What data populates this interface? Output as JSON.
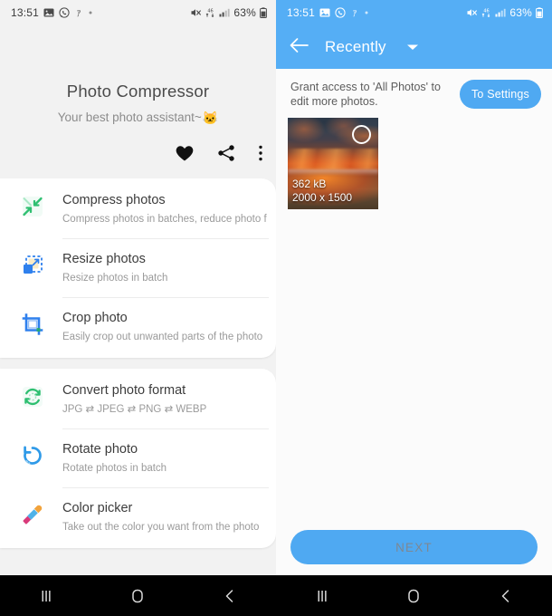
{
  "status_bar": {
    "time": "13:51",
    "left_icons": [
      "gallery-icon",
      "whatsapp-icon",
      "japanese-app-icon",
      "dot-icon"
    ],
    "right_icons": [
      "mute-icon",
      "network-transfer-icon",
      "signal-bars-icon"
    ],
    "battery_percent": "63%",
    "battery_icon": "battery-icon"
  },
  "left_screen": {
    "title": "Photo Compressor",
    "subtitle": "Your best photo assistant~",
    "subtitle_emoji": "🐱",
    "actions": [
      {
        "name": "favorite-button",
        "icon": "heart-icon"
      },
      {
        "name": "share-button",
        "icon": "share-icon"
      },
      {
        "name": "more-options-button",
        "icon": "more-vertical-icon"
      }
    ],
    "cards": [
      {
        "items": [
          {
            "title": "Compress photos",
            "desc": "Compress photos in batches, reduce photo fi..",
            "icon": "compress-arrows-icon"
          },
          {
            "title": "Resize photos",
            "desc": "Resize photos in batch",
            "icon": "resize-icon"
          },
          {
            "title": "Crop photo",
            "desc": "Easily crop out unwanted parts of the photo",
            "icon": "crop-icon"
          }
        ]
      },
      {
        "items": [
          {
            "title": "Convert photo format",
            "desc": "JPG ⇄ JPEG ⇄ PNG ⇄ WEBP",
            "icon": "convert-refresh-icon"
          },
          {
            "title": "Rotate photo",
            "desc": "Rotate photos in batch",
            "icon": "rotate-left-icon"
          },
          {
            "title": "Color picker",
            "desc": "Take out the color you want from the photo",
            "icon": "eyedropper-icon"
          }
        ]
      }
    ]
  },
  "right_screen": {
    "appbar": {
      "back_icon": "back-arrow-icon",
      "title": "Recently",
      "caret_icon": "chevron-down-icon"
    },
    "grant_banner": {
      "message": "Grant access to 'All Photos' to edit more photos.",
      "button_label": "To Settings"
    },
    "photos": [
      {
        "size": "362 kB",
        "dimensions": "2000 x 1500",
        "selected": false,
        "alt": "sunset-photo-thumbnail"
      }
    ],
    "next_button": "NEXT"
  },
  "nav_bar": {
    "recents_icon": "recents-icon",
    "home_icon": "home-icon",
    "back_icon": "back-icon"
  },
  "colors": {
    "accent_blue": "#55aef5",
    "button_blue": "#4fa9f2",
    "card_white": "#ffffff",
    "page_gray": "#f2f2f2"
  }
}
